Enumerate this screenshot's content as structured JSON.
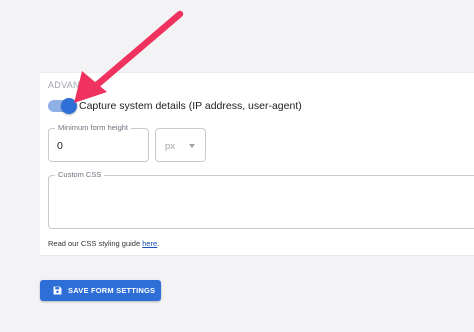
{
  "section": {
    "title": "ADVANCED"
  },
  "capture_toggle": {
    "label": "Capture system details (IP address, user-agent)",
    "enabled": true
  },
  "min_height": {
    "label": "Minimum form height",
    "value": "0"
  },
  "unit_select": {
    "selected": "px"
  },
  "custom_css": {
    "label": "Custom CSS",
    "value": ""
  },
  "guide": {
    "text": "Read our CSS styling guide ",
    "link": "here",
    "suffix": "."
  },
  "save_button": {
    "label": "SAVE FORM SETTINGS",
    "icon": "floppy-disk-icon"
  },
  "annotation": {
    "icon": "pointer-arrow-icon",
    "color": "#f0325e"
  },
  "colors": {
    "accent": "#2d6fd6",
    "toggle_track": "#8fb0e6",
    "background": "#f3f3f5"
  }
}
